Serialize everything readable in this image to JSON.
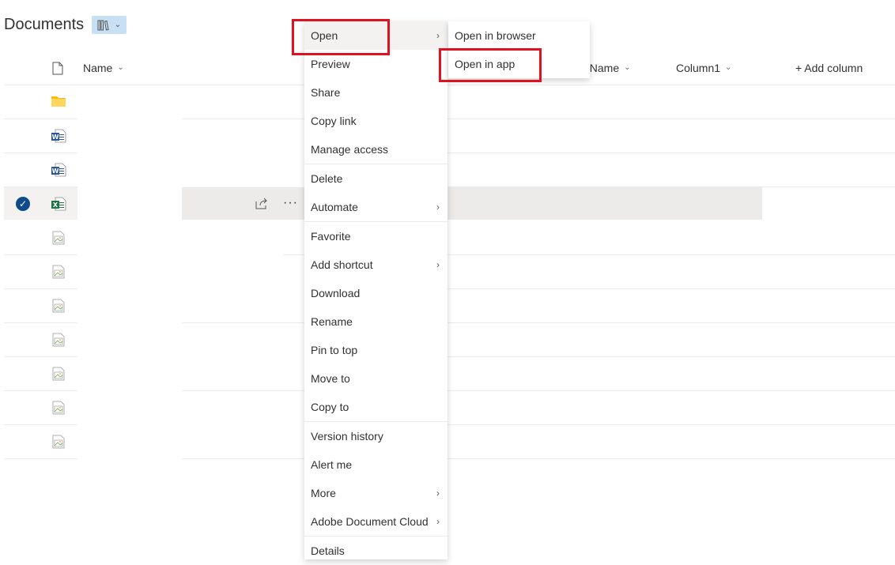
{
  "header": {
    "title": "Documents",
    "view_icon": "library-icon"
  },
  "columns": {
    "name": "Name",
    "partial_name": "t Name",
    "column1": "Column1",
    "add_column": "+ Add column"
  },
  "rows": [
    {
      "type": "folder-icon"
    },
    {
      "type": "word-file-icon"
    },
    {
      "type": "word-file-icon"
    },
    {
      "type": "excel-file-icon",
      "selected": true
    },
    {
      "type": "image-file-icon"
    },
    {
      "type": "image-file-icon"
    },
    {
      "type": "image-file-icon"
    },
    {
      "type": "image-file-icon"
    },
    {
      "type": "image-file-icon"
    },
    {
      "type": "image-file-icon"
    },
    {
      "type": "image-file-icon"
    }
  ],
  "row_actions": {
    "more": "···"
  },
  "context_menu": {
    "items": [
      {
        "label": "Open",
        "arrow": ">"
      },
      {
        "label": "Preview"
      },
      {
        "label": "Share"
      },
      {
        "label": "Copy link"
      },
      {
        "label": "Manage access"
      },
      {
        "label": "Delete"
      },
      {
        "label": "Automate",
        "arrow": ">"
      },
      {
        "label": "Favorite"
      },
      {
        "label": "Add shortcut",
        "arrow": ">"
      },
      {
        "label": "Download"
      },
      {
        "label": "Rename"
      },
      {
        "label": "Pin to top"
      },
      {
        "label": "Move to"
      },
      {
        "label": "Copy to"
      },
      {
        "label": "Version history"
      },
      {
        "label": "Alert me"
      },
      {
        "label": "More",
        "arrow": ">"
      },
      {
        "label": "Adobe Document Cloud",
        "arrow": ">"
      },
      {
        "label": "Details"
      }
    ]
  },
  "submenu": {
    "items": [
      {
        "label": "Open in browser"
      },
      {
        "label": "Open in app"
      }
    ]
  },
  "colors": {
    "highlight": "#e0121f",
    "selected_check": "#0f4a8a"
  }
}
